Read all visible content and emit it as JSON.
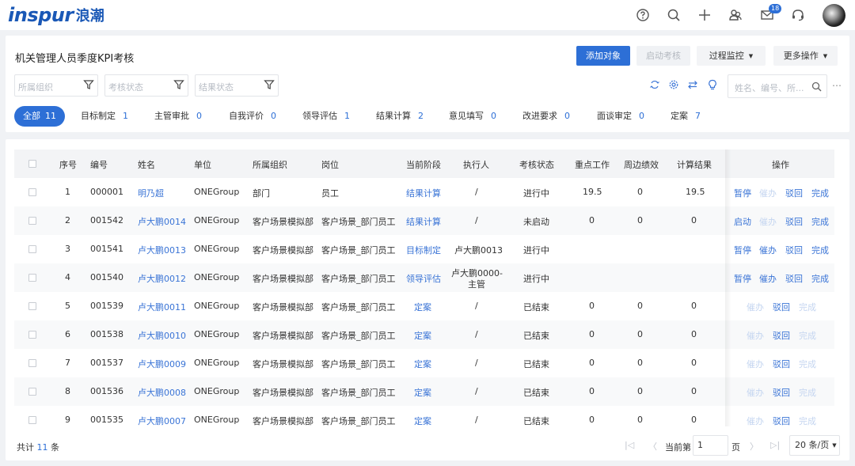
{
  "brand": {
    "logo_en": "inspur",
    "logo_cn": "浪潮"
  },
  "topbar": {
    "mail_badge": "18"
  },
  "page": {
    "title": "机关管理人员季度KPI考核",
    "add_button": "添加对象",
    "start_button": "启动考核",
    "monitor_button": "过程监控",
    "more_button": "更多操作"
  },
  "filters": {
    "org_placeholder": "所属组织",
    "status_placeholder": "考核状态",
    "result_placeholder": "结果状态"
  },
  "search": {
    "placeholder": "姓名、编号、所..."
  },
  "tabs": [
    {
      "label": "全部",
      "count": "11"
    },
    {
      "label": "目标制定",
      "count": "1"
    },
    {
      "label": "主管审批",
      "count": "0"
    },
    {
      "label": "自我评价",
      "count": "0"
    },
    {
      "label": "领导评估",
      "count": "1"
    },
    {
      "label": "结果计算",
      "count": "2"
    },
    {
      "label": "意见填写",
      "count": "0"
    },
    {
      "label": "改进要求",
      "count": "0"
    },
    {
      "label": "面谈审定",
      "count": "0"
    },
    {
      "label": "定案",
      "count": "7"
    }
  ],
  "table": {
    "headers": {
      "seq": "序号",
      "code": "编号",
      "name": "姓名",
      "unit": "单位",
      "org": "所属组织",
      "post": "岗位",
      "stage": "当前阶段",
      "executor": "执行人",
      "status": "考核状态",
      "key_work": "重点工作",
      "peripheral": "周边绩效",
      "result": "计算结果",
      "ops": "操作"
    },
    "rows": [
      {
        "seq": "1",
        "code": "000001",
        "name": "明乃超",
        "unit": "ONEGroup",
        "org": "部门",
        "post": "员工",
        "stage": "结果计算",
        "executor": "/",
        "status": "进行中",
        "key_work": "19.5",
        "peripheral": "0",
        "result": "19.5",
        "ops": [
          "暂停",
          "催办",
          "驳回",
          "完成"
        ]
      },
      {
        "seq": "2",
        "code": "001542",
        "name": "卢大鹏0014",
        "unit": "ONEGroup",
        "org": "客户场景模拟部",
        "post": "客户场景_部门员工",
        "stage": "结果计算",
        "executor": "/",
        "status": "未启动",
        "key_work": "0",
        "peripheral": "0",
        "result": "0",
        "ops": [
          "启动",
          "催办",
          "驳回",
          "完成"
        ]
      },
      {
        "seq": "3",
        "code": "001541",
        "name": "卢大鹏0013",
        "unit": "ONEGroup",
        "org": "客户场景模拟部",
        "post": "客户场景_部门员工",
        "stage": "目标制定",
        "executor": "卢大鹏0013",
        "status": "进行中",
        "key_work": "",
        "peripheral": "",
        "result": "",
        "ops": [
          "暂停",
          "催办",
          "驳回",
          "完成"
        ]
      },
      {
        "seq": "4",
        "code": "001540",
        "name": "卢大鹏0012",
        "unit": "ONEGroup",
        "org": "客户场景模拟部",
        "post": "客户场景_部门员工",
        "stage": "领导评估",
        "executor_line1": "卢大鹏0000-",
        "executor_line2": "主管",
        "status": "进行中",
        "key_work": "",
        "peripheral": "",
        "result": "",
        "ops": [
          "暂停",
          "催办",
          "驳回",
          "完成"
        ]
      },
      {
        "seq": "5",
        "code": "001539",
        "name": "卢大鹏0011",
        "unit": "ONEGroup",
        "org": "客户场景模拟部",
        "post": "客户场景_部门员工",
        "stage": "定案",
        "executor": "/",
        "status": "已结束",
        "key_work": "0",
        "peripheral": "0",
        "result": "0",
        "ops": [
          "催办",
          "驳回",
          "完成"
        ]
      },
      {
        "seq": "6",
        "code": "001538",
        "name": "卢大鹏0010",
        "unit": "ONEGroup",
        "org": "客户场景模拟部",
        "post": "客户场景_部门员工",
        "stage": "定案",
        "executor": "/",
        "status": "已结束",
        "key_work": "0",
        "peripheral": "0",
        "result": "0",
        "ops": [
          "催办",
          "驳回",
          "完成"
        ]
      },
      {
        "seq": "7",
        "code": "001537",
        "name": "卢大鹏0009",
        "unit": "ONEGroup",
        "org": "客户场景模拟部",
        "post": "客户场景_部门员工",
        "stage": "定案",
        "executor": "/",
        "status": "已结束",
        "key_work": "0",
        "peripheral": "0",
        "result": "0",
        "ops": [
          "催办",
          "驳回",
          "完成"
        ]
      },
      {
        "seq": "8",
        "code": "001536",
        "name": "卢大鹏0008",
        "unit": "ONEGroup",
        "org": "客户场景模拟部",
        "post": "客户场景_部门员工",
        "stage": "定案",
        "executor": "/",
        "status": "已结束",
        "key_work": "0",
        "peripheral": "0",
        "result": "0",
        "ops": [
          "催办",
          "驳回",
          "完成"
        ]
      },
      {
        "seq": "9",
        "code": "001535",
        "name": "卢大鹏0007",
        "unit": "ONEGroup",
        "org": "客户场景模拟部",
        "post": "客户场景_部门员工",
        "stage": "定案",
        "executor": "/",
        "status": "已结束",
        "key_work": "0",
        "peripheral": "0",
        "result": "0",
        "ops": [
          "催办",
          "驳回",
          "完成"
        ]
      }
    ]
  },
  "footer": {
    "total_prefix": "共计",
    "total_count": "11",
    "total_suffix": "条",
    "current_page_label": "当前第",
    "current_page": "1",
    "page_unit": "页",
    "page_size": "20 条/页"
  }
}
